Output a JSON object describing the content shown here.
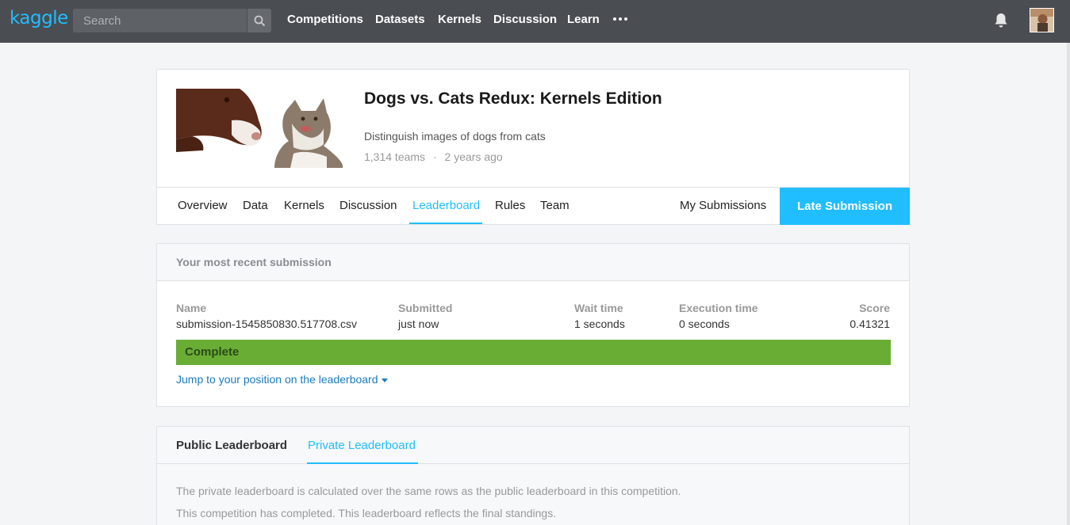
{
  "brand": {
    "logo": "kaggle"
  },
  "search": {
    "placeholder": "Search"
  },
  "nav": {
    "items": [
      "Competitions",
      "Datasets",
      "Kernels",
      "Discussion",
      "Learn"
    ]
  },
  "competition": {
    "title": "Dogs vs. Cats Redux: Kernels Edition",
    "subtitle": "Distinguish images of dogs from cats",
    "teams": "1,314 teams",
    "separator": "·",
    "age": "2 years ago"
  },
  "tabs": {
    "items": [
      "Overview",
      "Data",
      "Kernels",
      "Discussion",
      "Leaderboard",
      "Rules",
      "Team"
    ],
    "active": "Leaderboard",
    "my_submissions": "My Submissions",
    "late_submission": "Late Submission"
  },
  "submission": {
    "heading": "Your most recent submission",
    "columns": [
      "Name",
      "Submitted",
      "Wait time",
      "Execution time",
      "Score"
    ],
    "values": [
      "submission-1545850830.517708.csv",
      "just now",
      "1 seconds",
      "0 seconds",
      "0.41321"
    ],
    "status": "Complete",
    "jump_link": "Jump to your position on the leaderboard"
  },
  "leaderboard": {
    "tabs": [
      "Public Leaderboard",
      "Private Leaderboard"
    ],
    "active": "Private Leaderboard",
    "notes": [
      "The private leaderboard is calculated over the same rows as the public leaderboard in this competition.",
      "This competition has completed. This leaderboard reflects the final standings."
    ]
  },
  "colors": {
    "accent": "#20beff",
    "nav_bg": "#4a4d52",
    "status_complete": "#6aad35",
    "link": "#1a7bbd"
  }
}
